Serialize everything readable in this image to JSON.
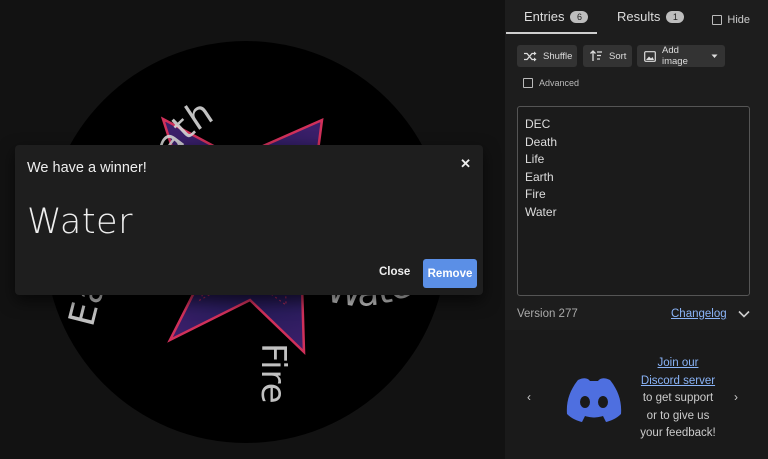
{
  "tabs": [
    {
      "label": "Entries",
      "count": "6"
    },
    {
      "label": "Results",
      "count": "1"
    }
  ],
  "hide_label": "Hide",
  "toolbar": {
    "shuffle_label": "Shuffle",
    "sort_label": "Sort",
    "add_image_label": "Add image"
  },
  "advanced_label": "Advanced",
  "entries": [
    "DEC",
    "Death",
    "Life",
    "Earth",
    "Fire",
    "Water"
  ],
  "version_label": "Version 277",
  "changelog_label": "Changelog",
  "support": {
    "link_line1": "Join our",
    "link_line2": "Discord server",
    "line3": "to get support",
    "line4": "or to give us",
    "line5": "your feedback!"
  },
  "wheel": {
    "labels": [
      "Death",
      "Water",
      "Fire",
      "Earth"
    ]
  },
  "modal": {
    "title": "We have a winner!",
    "winner": "Water",
    "close_label": "Close",
    "remove_label": "Remove"
  },
  "colors": {
    "accent": "#5b8fe6",
    "link": "#8ab4f8",
    "discord": "#4e6fe0",
    "star_stroke": "#d0305a",
    "star_fill": "#251a55"
  }
}
